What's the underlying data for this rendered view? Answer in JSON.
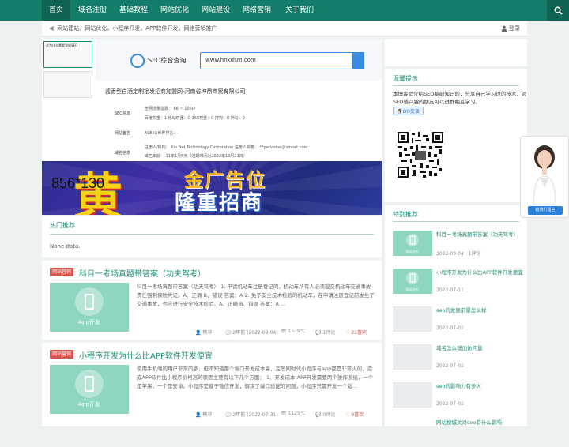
{
  "nav": {
    "items": [
      "首页",
      "域名注册",
      "基础教程",
      "网站优化",
      "网站建设",
      "网络营销",
      "关于我们"
    ],
    "active": "首页"
  },
  "topbar": {
    "notice": "网站建站，网站优化，小程序开发，APP软件开发，网络营销推广",
    "login": "登录"
  },
  "slider": {
    "thumb_caption": "这为什么需要学的SEO",
    "seo": {
      "title": "SEO综合查询",
      "domain": "www.hnkdsm.com",
      "company": "酱香型白酒定制批发招商加盟网-河南省坤鼎商贸有限公司",
      "side_items": [
        "SEO信息",
        "网站备名",
        "域名信息"
      ],
      "rows": [
        "全网流量指数： 66 ~ 106IP",
        "百度权重：1    移动权重：0    360权重：0    搜狗：0    神马：0",
        "ALEXA世界排名：-",
        "注册人/机构： Xin Net Technology Corporation    注册人邮箱： **pervision@xinnet.com",
        "域名年龄：    11年1月5天（过期时间为2022年10月21日）"
      ]
    },
    "banner": {
      "dimension": "856*130",
      "line1": "金广告位",
      "line2": "隆重招商"
    }
  },
  "hot": {
    "title": "热门推荐",
    "empty": "None data."
  },
  "posts": [
    {
      "category": "网站营销",
      "title": "科目一考场真题带答案（功夫驾考）",
      "image_label": "App开发",
      "excerpt": "科目一考场真题带答案（功夫驾考）  1. 申请机动车注册登记的，机动车所有人必须提交机动车交通事故责任强制保险凭证。A、正确 B、错误    答案：A     2. 免予安全技术检验的机动车，在申请注册登记前发生了交通事故，也应进行安全技术检验。A、正确 B、错误    答案：A ...",
      "author": "韩非",
      "time": "2年前 (2022-09-04)",
      "views": "1579℃",
      "comments": "1评论",
      "likes": "21喜欢"
    },
    {
      "category": "网站营销",
      "title": "小程序开发为什么比APP软件开发便宜",
      "image_label": "App开发",
      "excerpt": "使用手机端的用户非常的多，但不知道那个端口开发成本高，互联网时代小程序与app都是非常火的，造成APP软件比小程序价格高的原因主要有以下几个方面：  1、开发成本 APP开发需要两个操作系统，一个是苹果，一个是安卓。小程序是基于微信开发，解决了端口适配的问题，小程序只需开发一个版...",
      "author": "韩非",
      "time": "2年前 (2022-07-31)",
      "views": "1125℃",
      "comments": "0评论",
      "likes": "9喜欢"
    }
  ],
  "sidebar": {
    "tips": {
      "title": "温馨提示",
      "text": "本博客是介绍SEO基础知识的，分享自己学习过的技术，对SEO感兴趣的朋友可以进群相互学习。",
      "qq": "QQ交谈"
    },
    "special": {
      "title": "特别推荐",
      "items": [
        {
          "title": "科目一考场真题带答案（功夫驾考）",
          "date": "2022-09-04",
          "comments": "1评论",
          "img": "SEO评分"
        },
        {
          "title": "小程序开发为什么比APP软件开发便宜",
          "date": "2022-07-11",
          "img": "SEO评分"
        },
        {
          "title": "seo的发展前景怎么样",
          "date": "2022-07-02"
        },
        {
          "title": "域名怎么增加访问量",
          "date": "2022-07-02"
        },
        {
          "title": "seo的影响力有多大",
          "date": "2022-07-02"
        },
        {
          "title": "网站搜城关对seo有什么影响",
          "date": ""
        }
      ]
    }
  },
  "float_widget": {
    "button": "给我们留言"
  },
  "colors": {
    "brand": "#147d69",
    "accent": "#1a8a73",
    "category": "#d9534f",
    "likes": "#d9534f"
  }
}
